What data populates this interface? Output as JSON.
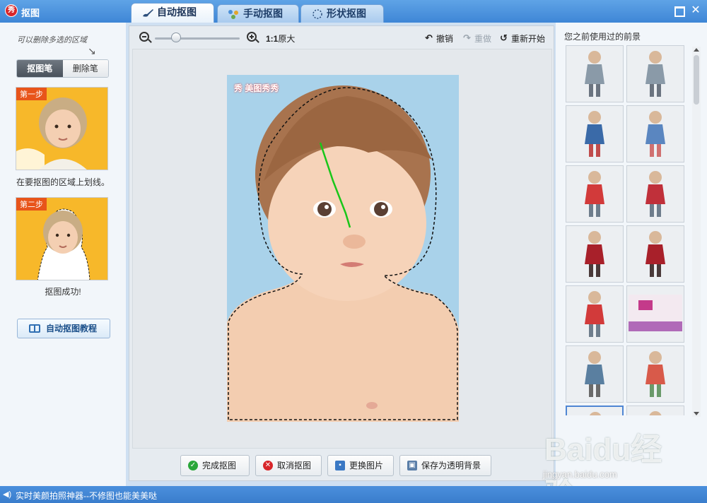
{
  "window": {
    "title": "抠图",
    "logo_text": "秀"
  },
  "tabs": [
    {
      "label": "自动抠图",
      "icon": "brush-icon",
      "active": true
    },
    {
      "label": "手动抠图",
      "icon": "points-icon",
      "active": false
    },
    {
      "label": "形状抠图",
      "icon": "shape-icon",
      "active": false
    }
  ],
  "left_panel": {
    "hint": "可以删除多选的区域",
    "pen_buttons": [
      {
        "label": "抠图笔",
        "active": true
      },
      {
        "label": "删除笔",
        "active": false
      }
    ],
    "steps": [
      {
        "badge": "第一步",
        "caption": "在要抠图的区域上划线。"
      },
      {
        "badge": "第二步",
        "caption": "抠图成功!"
      }
    ],
    "tutorial_button": "自动抠图教程"
  },
  "toolbar": {
    "zoom_ratio": "1:1",
    "zoom_text": "原大",
    "zoom_level": 0.25,
    "undo": "撤销",
    "redo": "重做",
    "restart": "重新开始"
  },
  "photo": {
    "logo_text": "美图秀秀",
    "logo_mark": "秀"
  },
  "bottom_buttons": [
    {
      "label": "完成抠图",
      "icon": "check-icon",
      "color": "#2aa63a"
    },
    {
      "label": "取消抠图",
      "icon": "cancel-icon",
      "color": "#d8262a"
    },
    {
      "label": "更换图片",
      "icon": "picture-icon",
      "color": "#3a78c4"
    },
    {
      "label": "保存为透明背景",
      "icon": "save-icon",
      "color": "#5a7ea8"
    }
  ],
  "right_panel": {
    "title": "您之前使用过的前景",
    "thumbnails": [
      {
        "name": "elder-figure-1",
        "icon": "figure-icon"
      },
      {
        "name": "elder-figure-2",
        "icon": "figure-icon"
      },
      {
        "name": "walking-boy-1",
        "icon": "figure-icon"
      },
      {
        "name": "walking-boy-2",
        "icon": "figure-icon"
      },
      {
        "name": "girl-red-dress-1",
        "icon": "figure-icon"
      },
      {
        "name": "girl-red-dress-2",
        "icon": "figure-icon"
      },
      {
        "name": "girl-dark-red-1",
        "icon": "figure-icon"
      },
      {
        "name": "girl-dark-red-2",
        "icon": "figure-icon"
      },
      {
        "name": "girl-red-dress-3",
        "icon": "figure-icon"
      },
      {
        "name": "room-drawing",
        "icon": "picture-icon"
      },
      {
        "name": "standing-man",
        "icon": "figure-icon"
      },
      {
        "name": "bicycle-kid",
        "icon": "figure-icon"
      },
      {
        "name": "elder-figure-3",
        "icon": "figure-icon"
      },
      {
        "name": "partial-figure",
        "icon": "figure-icon"
      }
    ]
  },
  "status_bar": {
    "text": "实时美颜拍照神器--不修图也能美美哒",
    "icon": "speaker-icon"
  },
  "watermark": {
    "main": "Baidu经验",
    "sub": "jingyan.baidu.com"
  }
}
